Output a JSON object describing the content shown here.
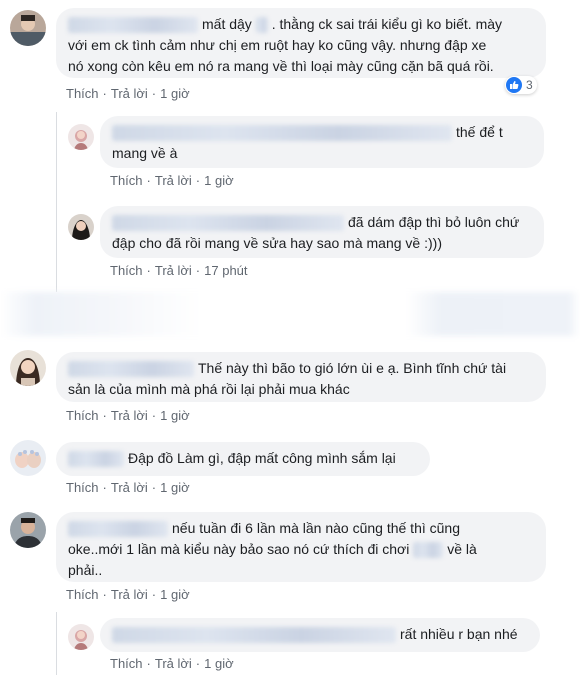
{
  "comments": [
    {
      "text": "mất dậy . thằng ck sai trái kiểu gì ko biết. mày với em ck tình cảm như chị em ruột hay ko cũng vậy. nhưng đập xe nó xong còn kêu em nó ra mang về thì loại mày cũng cặn bã quá rồi.",
      "line1": "mất dậy",
      "line1b": ". thằng ck sai trái kiểu gì ko biết. mày",
      "line2": "với em ck tình cảm như chị em ruột hay ko cũng vậy. nhưng đập xe",
      "line3": "nó xong còn kêu em nó ra mang về thì loại mày cũng cặn bã quá rồi.",
      "like": "Thích",
      "reply": "Trả lời",
      "time": "1 giờ",
      "reaction_count": "3",
      "replies": [
        {
          "line1": "thế để t",
          "line2": "mang về à",
          "like": "Thích",
          "reply": "Trả lời",
          "time": "1 giờ"
        },
        {
          "line1": "đã dám đập thì bỏ luôn chứ",
          "line2": "đập cho đã rồi mang về sửa hay sao mà mang về :)))",
          "like": "Thích",
          "reply": "Trả lời",
          "time": "17 phút"
        }
      ]
    },
    {
      "line1": "Thế này thì bão to gió lớn ùi e ạ. Bình tĩnh chứ tài",
      "line2": "sản là của mình mà phá rồi lại phải mua khác",
      "like": "Thích",
      "reply": "Trả lời",
      "time": "1 giờ"
    },
    {
      "line1": "Đập đồ Làm gì, đập mất công mình sắm lại",
      "like": "Thích",
      "reply": "Trả lời",
      "time": "1 giờ"
    },
    {
      "line1": "nếu tuần đi 6 lần mà lần nào cũng thế thì cũng",
      "line2a": "oke..mới 1 lần mà kiểu này bảo sao nó cứ thích đi chơi",
      "line2b": "về là",
      "line3": "phải..",
      "like": "Thích",
      "reply": "Trả lời",
      "time": "1 giờ",
      "replies": [
        {
          "line1": "rất nhiều r bạn nhé",
          "like": "Thích",
          "reply": "Trả lời",
          "time": "1 giờ"
        }
      ]
    }
  ],
  "colors": {
    "bubble": "#f2f3f5",
    "meta": "#606770",
    "like_blue": "#2078f4"
  }
}
